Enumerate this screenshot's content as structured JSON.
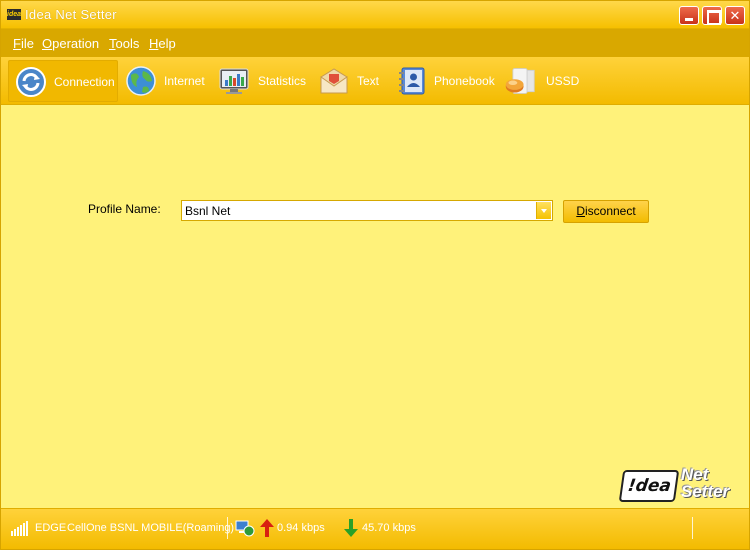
{
  "window": {
    "title": "Idea Net Setter",
    "logo_text": "idea"
  },
  "menu": {
    "items": [
      {
        "key": "F",
        "rest": "ile"
      },
      {
        "key": "O",
        "rest": "peration"
      },
      {
        "key": "T",
        "rest": "ools"
      },
      {
        "key": "H",
        "rest": "elp"
      }
    ]
  },
  "toolbar": {
    "items": [
      {
        "label": "Connection",
        "icon": "connection-icon",
        "active": true
      },
      {
        "label": "Internet",
        "icon": "globe-icon",
        "active": false
      },
      {
        "label": "Statistics",
        "icon": "monitor-chart-icon",
        "active": false
      },
      {
        "label": "Text",
        "icon": "envelope-icon",
        "active": false
      },
      {
        "label": "Phonebook",
        "icon": "phonebook-icon",
        "active": false
      },
      {
        "label": "USSD",
        "icon": "ussd-icon",
        "active": false
      }
    ]
  },
  "connection": {
    "profile_label": "Profile Name:",
    "profile_value": "Bsnl Net",
    "disconnect_key": "D",
    "disconnect_rest": "isconnect"
  },
  "brand": {
    "idea": "!dea",
    "net": "Net",
    "setter": "Setter"
  },
  "status": {
    "network_type": "EDGE",
    "operator": "CellOne BSNL MOBILE(Roaming)",
    "upload_speed": "0.94 kbps",
    "download_speed": "45.70 kbps"
  },
  "colors": {
    "accent": "#f5c000",
    "content_bg": "#fff27a",
    "close_button": "#d8401f"
  }
}
